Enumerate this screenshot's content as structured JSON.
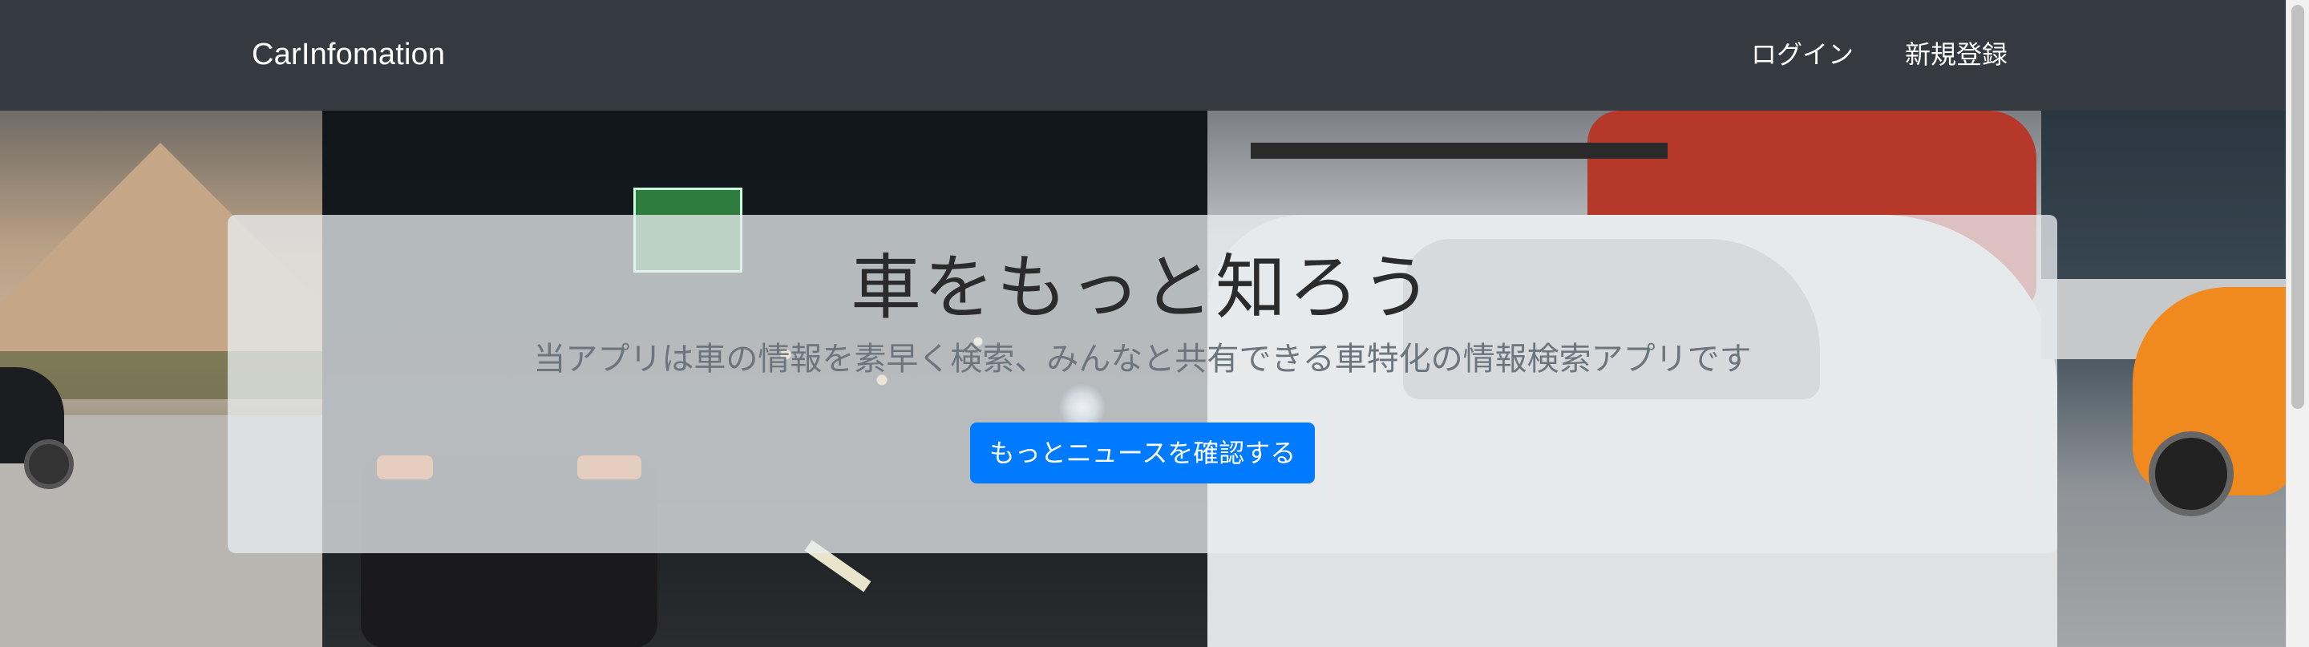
{
  "navbar": {
    "brand": "CarInfomation",
    "links": [
      "ログイン",
      "新規登録"
    ]
  },
  "hero": {
    "title": "車をもっと知ろう",
    "lead": "当アプリは車の情報を素早く検索、みんなと共有できる車特化の情報検索アプリです",
    "button_label": "もっとニュースを確認する"
  },
  "colors": {
    "navbar_bg": "#343a40",
    "button_bg": "#007bff",
    "jumbotron_bg": "rgba(233,236,239,0.76)"
  }
}
